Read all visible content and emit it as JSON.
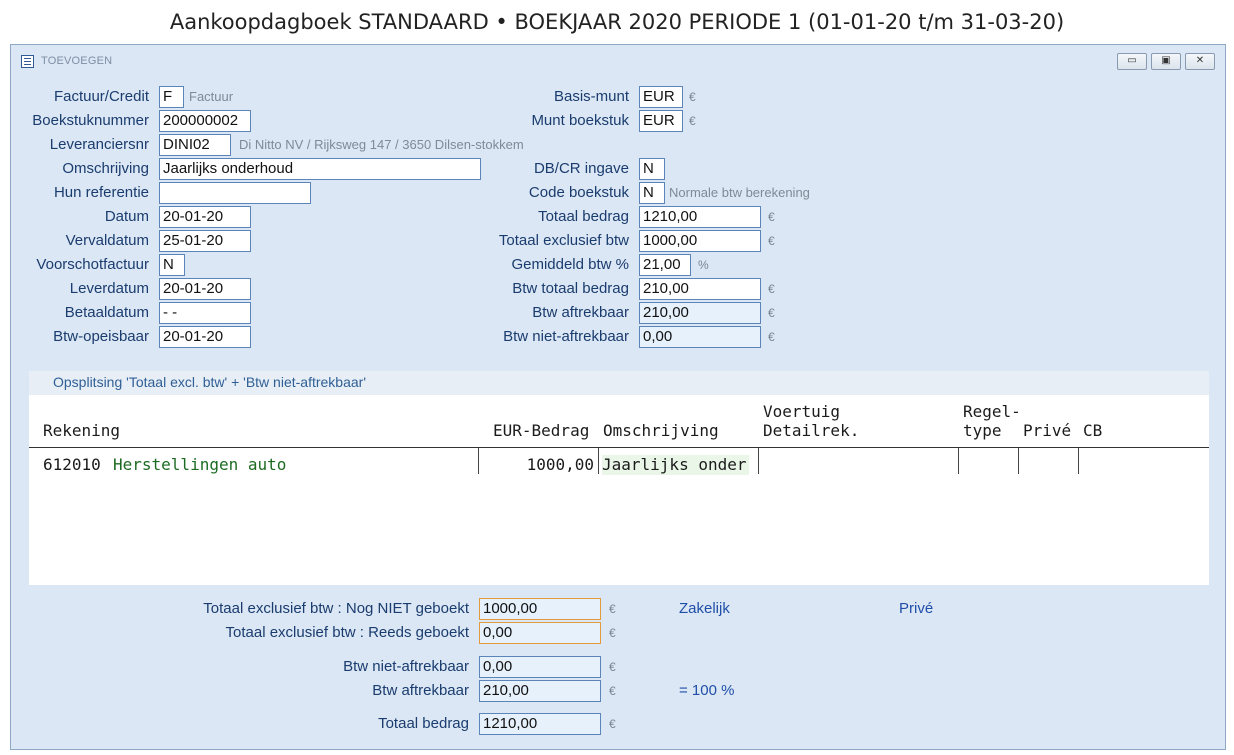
{
  "page_title": "Aankoopdagboek STANDAARD • BOEKJAAR 2020 PERIODE 1 (01-01-20 t/m 31-03-20)",
  "window": {
    "title": "TOEVOEGEN",
    "buttons": {
      "minimize": "▭",
      "restore": "▣",
      "close": "✕"
    }
  },
  "left_form": {
    "factuur_credit": {
      "label": "Factuur/Credit",
      "value": "F",
      "hint": "Factuur"
    },
    "boekstuknummer": {
      "label": "Boekstuknummer",
      "value": "200000002"
    },
    "leveranciersnr": {
      "label": "Leveranciersnr",
      "value": "DINI02",
      "hint": "Di Nitto NV / Rijksweg 147 / 3650 Dilsen-stokkem"
    },
    "omschrijving": {
      "label": "Omschrijving",
      "value": "Jaarlijks onderhoud"
    },
    "hun_referentie": {
      "label": "Hun referentie",
      "value": ""
    },
    "datum": {
      "label": "Datum",
      "value": "20-01-20"
    },
    "vervaldatum": {
      "label": "Vervaldatum",
      "value": "25-01-20"
    },
    "voorschotfactuur": {
      "label": "Voorschotfactuur",
      "value": "N"
    },
    "leverdatum": {
      "label": "Leverdatum",
      "value": "20-01-20"
    },
    "betaaldatum": {
      "label": "Betaaldatum",
      "value": "- -"
    },
    "btw_opeisbaar": {
      "label": "Btw-opeisbaar",
      "value": "20-01-20"
    }
  },
  "right_form": {
    "basis_munt": {
      "label": "Basis-munt",
      "value": "EUR",
      "unit": "€"
    },
    "munt_boekstuk": {
      "label": "Munt boekstuk",
      "value": "EUR",
      "unit": "€"
    },
    "db_cr_ingave": {
      "label": "DB/CR ingave",
      "value": "N"
    },
    "code_boekstuk": {
      "label": "Code boekstuk",
      "value": "N",
      "hint": "Normale btw berekening"
    },
    "totaal_bedrag": {
      "label": "Totaal bedrag",
      "value": "1210,00",
      "unit": "€"
    },
    "totaal_excl": {
      "label": "Totaal exclusief btw",
      "value": "1000,00",
      "unit": "€"
    },
    "gem_btw": {
      "label": "Gemiddeld btw %",
      "value": "21,00",
      "unit": "%"
    },
    "btw_totaal": {
      "label": "Btw totaal bedrag",
      "value": "210,00",
      "unit": "€"
    },
    "btw_aftrekbaar": {
      "label": "Btw aftrekbaar",
      "value": "210,00",
      "unit": "€"
    },
    "btw_niet_aftrekbaar": {
      "label": "Btw niet-aftrekbaar",
      "value": "0,00",
      "unit": "€"
    }
  },
  "grid": {
    "title": "Opsplitsing 'Totaal excl. btw' + 'Btw niet-aftrekbaar'",
    "columns": {
      "rekening": "Rekening",
      "bedrag": "EUR-Bedrag",
      "omschrijving": "Omschrijving",
      "voertuig_1": "Voertuig",
      "voertuig_2": "Detailrek.",
      "regel_1": "Regel-",
      "regel_2": "type",
      "prive": "Privé",
      "cb": "CB"
    },
    "rows": [
      {
        "account": "612010",
        "account_name": "Herstellingen auto",
        "amount": "1000,00",
        "description": "Jaarlijks onder"
      }
    ]
  },
  "totals": {
    "nog_niet": {
      "label": "Totaal exclusief btw : Nog NIET geboekt",
      "value": "1000,00",
      "unit": "€"
    },
    "reeds": {
      "label": "Totaal exclusief btw : Reeds geboekt",
      "value": "0,00",
      "unit": "€"
    },
    "niet_aftrek": {
      "label": "Btw niet-aftrekbaar",
      "value": "0,00",
      "unit": "€"
    },
    "aftrek": {
      "label": "Btw aftrekbaar",
      "value": "210,00",
      "unit": "€"
    },
    "totaal": {
      "label": "Totaal bedrag",
      "value": "1210,00",
      "unit": "€"
    },
    "zakelijk": "Zakelijk",
    "prive": "Privé",
    "percent": "= 100 %"
  }
}
